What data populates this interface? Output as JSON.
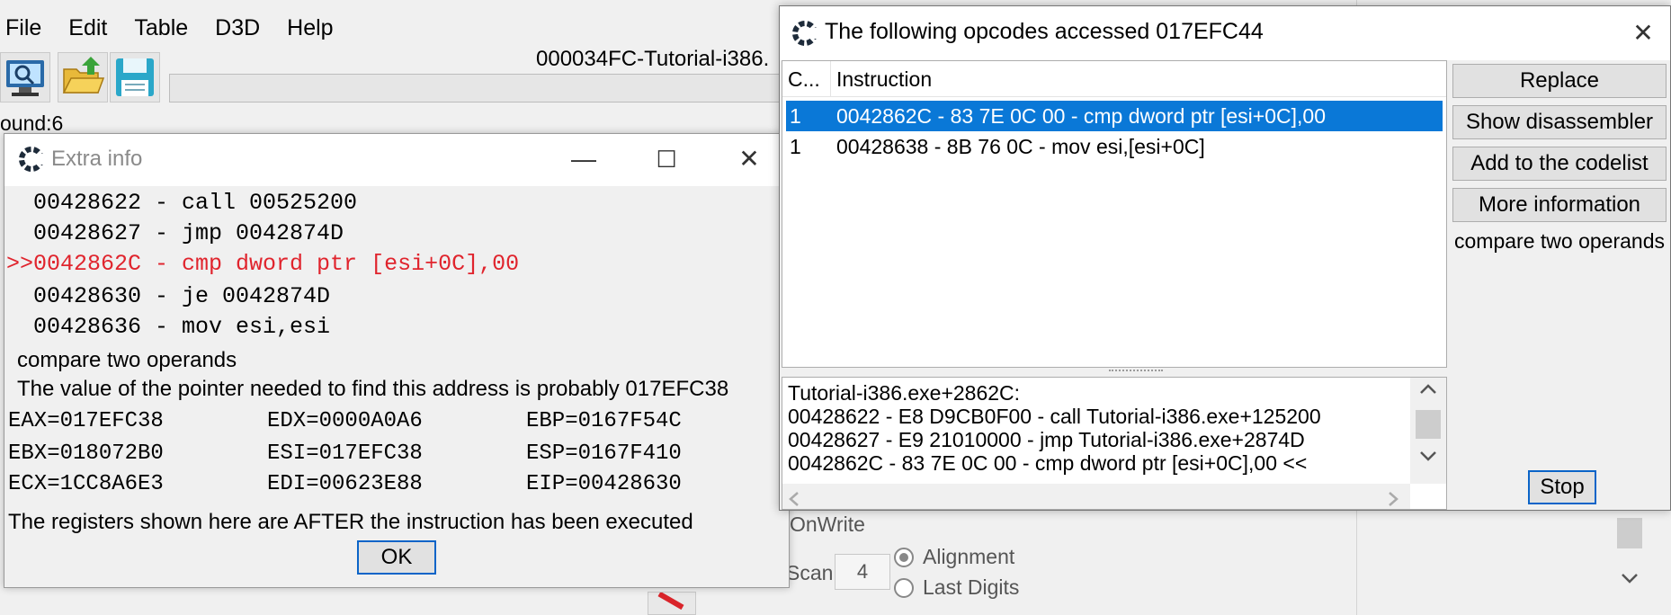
{
  "main": {
    "menu": [
      "File",
      "Edit",
      "Table",
      "D3D",
      "Help"
    ],
    "process_title": "000034FC-Tutorial-i386.",
    "found_label": "ound:6",
    "onwrite_label": "OnWrite",
    "scan_label": "Scan",
    "scan_value": "4",
    "radio_alignment": "Alignment",
    "radio_last_digits": "Last Digits",
    "icons": [
      "computer-icon",
      "open-folder-icon",
      "save-icon"
    ]
  },
  "extra_info": {
    "title": "Extra info",
    "asm_lines": [
      "  00428622 - call 00525200",
      "  00428627 - jmp 0042874D",
      ">>0042862C - cmp dword ptr [esi+0C],00",
      "  00428630 - je 0042874D",
      "  00428636 - mov esi,esi"
    ],
    "description": "compare two operands",
    "pointer_text": "The value of the pointer needed to find this address is probably 017EFC38",
    "registers": [
      [
        "EAX=017EFC38",
        "EDX=0000A0A6",
        "EBP=0167F54C"
      ],
      [
        "EBX=018072B0",
        "ESI=017EFC38",
        "ESP=0167F410"
      ],
      [
        "ECX=1CC8A6E3",
        "EDI=00623E88",
        "EIP=00428630"
      ]
    ],
    "note": "The registers shown here are AFTER the instruction has been executed",
    "ok_label": "OK",
    "controls": {
      "minimize": "—",
      "maximize": "☐",
      "close": "✕"
    },
    "highlight_color": "#e0242d"
  },
  "opcodes": {
    "title": "The following opcodes accessed 017EFC44",
    "close": "✕",
    "columns": {
      "count": "C...",
      "instruction": "Instruction"
    },
    "rows": [
      {
        "count": "1",
        "instruction": "0042862C - 83 7E 0C 00 - cmp dword ptr [esi+0C],00"
      },
      {
        "count": "1",
        "instruction": "00428638 - 8B 76 0C  - mov esi,[esi+0C]"
      }
    ],
    "details": [
      "Tutorial-i386.exe+2862C:",
      "00428622 - E8 D9CB0F00 - call Tutorial-i386.exe+125200",
      "00428627 - E9 21010000 - jmp Tutorial-i386.exe+2874D",
      "0042862C - 83 7E 0C 00 - cmp dword ptr [esi+0C],00 <<"
    ],
    "buttons": {
      "replace": "Replace",
      "show_disassembler": "Show disassembler",
      "add_to_codelist": "Add to the codelist",
      "more_information": "More information"
    },
    "description": "compare two operands",
    "stop_label": "Stop",
    "selection_color": "#0a78d7"
  }
}
